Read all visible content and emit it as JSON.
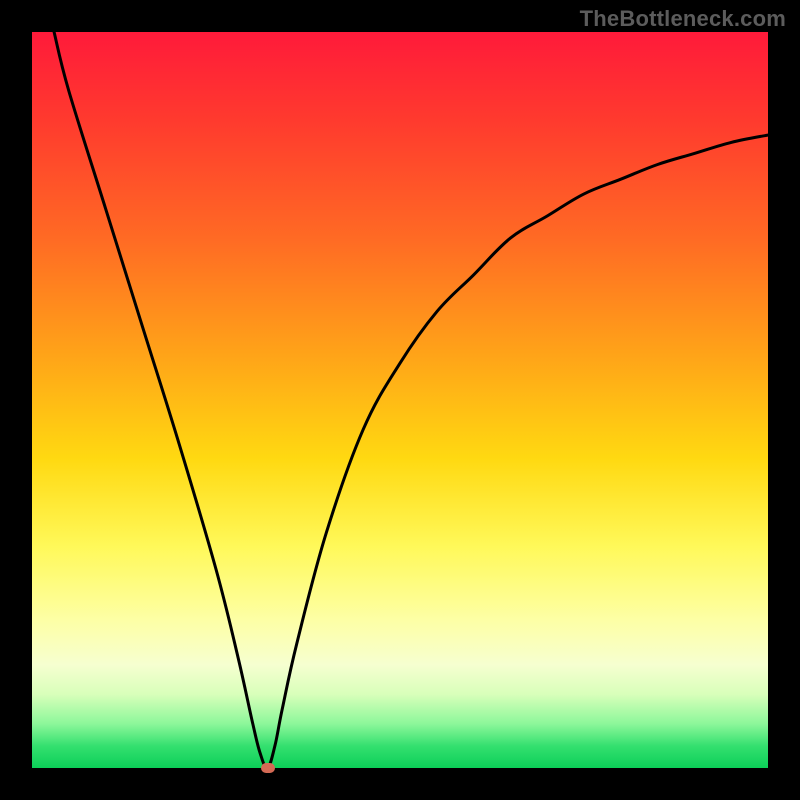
{
  "watermark": "TheBottleneck.com",
  "chart_data": {
    "type": "line",
    "title": "",
    "xlabel": "",
    "ylabel": "",
    "xlim": [
      0,
      100
    ],
    "ylim": [
      0,
      100
    ],
    "grid": false,
    "legend": false,
    "series": [
      {
        "name": "bottleneck-curve",
        "x": [
          3,
          5,
          10,
          15,
          20,
          25,
          28,
          30,
          31,
          32,
          33,
          34,
          36,
          40,
          45,
          50,
          55,
          60,
          65,
          70,
          75,
          80,
          85,
          90,
          95,
          100
        ],
        "y": [
          100,
          92,
          76,
          60,
          44,
          27,
          15,
          6,
          2,
          0,
          3,
          8,
          17,
          32,
          46,
          55,
          62,
          67,
          72,
          75,
          78,
          80,
          82,
          83.5,
          85,
          86
        ]
      }
    ],
    "marker": {
      "x": 32,
      "y": 0
    },
    "background": "rainbow-vertical"
  }
}
